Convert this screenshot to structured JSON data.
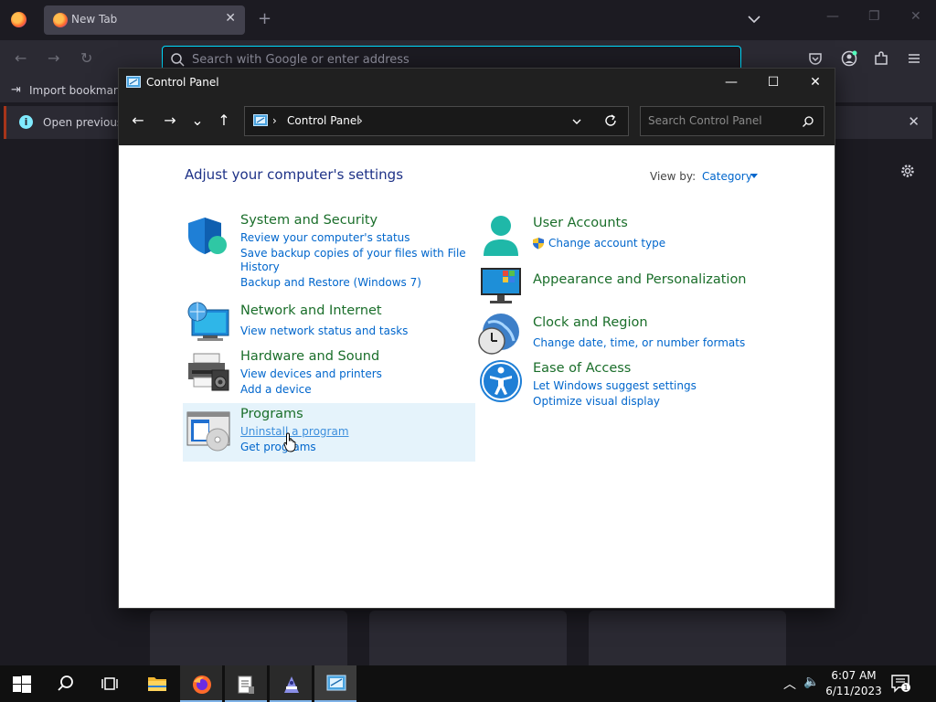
{
  "browser": {
    "tab_title": "New Tab",
    "tab_close": "✕",
    "new_tab": "+",
    "url_placeholder": "Search with Google or enter address",
    "bookmarks_import": "Import bookmarks...",
    "notification_text": "Open previous t",
    "notification_close": "✕",
    "win_minimize": "—",
    "win_restore": "❐",
    "win_close": "✕"
  },
  "control_panel": {
    "window_title": "Control Panel",
    "win_minimize": "—",
    "win_maximize": "☐",
    "win_close": "✕",
    "nav_back": "←",
    "nav_forward": "→",
    "nav_recent": "⌄",
    "nav_up": "↑",
    "address_sep": "›",
    "address_text": "Control Panel",
    "address_sep2": "›",
    "search_placeholder": "Search Control Panel",
    "heading": "Adjust your computer's settings",
    "view_by_label": "View by:",
    "view_by_value": "Category",
    "categories": [
      {
        "title": "System and Security",
        "links": [
          "Review your computer's status",
          "Save backup copies of your files with File",
          "History",
          "Backup and Restore (Windows 7)"
        ]
      },
      {
        "title": "Network and Internet",
        "links": [
          "View network status and tasks"
        ]
      },
      {
        "title": "Hardware and Sound",
        "links": [
          "View devices and printers",
          "Add a device"
        ]
      },
      {
        "title": "Programs",
        "links": [
          "Uninstall a program",
          "Get programs"
        ]
      },
      {
        "title": "User Accounts",
        "links": [
          "Change account type"
        ]
      },
      {
        "title": "Appearance and Personalization",
        "links": []
      },
      {
        "title": "Clock and Region",
        "links": [
          "Change date, time, or number formats"
        ]
      },
      {
        "title": "Ease of Access",
        "links": [
          "Let Windows suggest settings",
          "Optimize visual display"
        ]
      }
    ]
  },
  "taskbar": {
    "time": "6:07 AM",
    "date": "6/11/2023",
    "tray_chevron": "︿",
    "volume": "🔈",
    "notification_count": "1"
  },
  "colors": {
    "category_title": "#1a6e2a",
    "link": "#0066cc",
    "heading": "#1e3287",
    "hover_bg": "#e5f3fb"
  }
}
